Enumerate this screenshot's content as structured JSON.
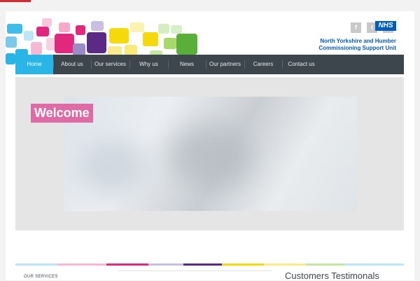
{
  "social": [
    "f",
    "t",
    "in"
  ],
  "nhs_logo": "NHS",
  "org_name": "North Yorkshire and Humber Commissioning Support Unit",
  "nav": [
    {
      "label": "Home",
      "active": true
    },
    {
      "label": "About us"
    },
    {
      "label": "Our services"
    },
    {
      "label": "Why us"
    },
    {
      "label": "News"
    },
    {
      "label": "Our partners"
    },
    {
      "label": "Careers"
    },
    {
      "label": "Contact us"
    }
  ],
  "banner": {
    "welcome": "Welcome"
  },
  "footer": {
    "services_label": "OUR SERVICES",
    "testimonials_title": "Customers Testimonals"
  },
  "colors": {
    "nav_bg": "#3d464d",
    "nav_active": "#29b6e6",
    "welcome_bg": "#de6aa6",
    "nhs_blue": "#005eb8"
  }
}
